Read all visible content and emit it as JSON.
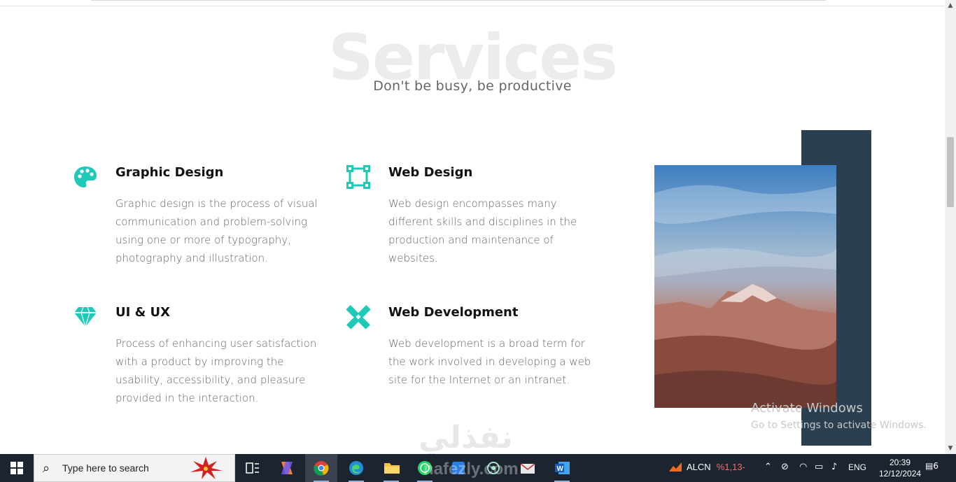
{
  "section": {
    "title": "Services",
    "subtitle": "Don't be busy, be productive"
  },
  "services": [
    {
      "title": "Graphic Design",
      "icon": "palette-icon",
      "description": "Graphic design is the process of visual communication and problem-solving using one or more of typography, photography and illustration."
    },
    {
      "title": "Web Design",
      "icon": "vector-square-icon",
      "description": "Web design encompasses many different skills and disciplines in the production and maintenance of websites."
    },
    {
      "title": "UI & UX",
      "icon": "gem-icon",
      "description": "Process of enhancing user satisfaction with a product by improving the usability, accessibility, and pleasure provided in the interaction."
    },
    {
      "title": "Web Development",
      "icon": "pencil-ruler-icon",
      "description": "Web development is a broad term for the work involved in developing a web site for the Internet or an intranet."
    }
  ],
  "colors": {
    "accent": "#1fc9b8",
    "dark_block": "#2a3f4f"
  },
  "watermarks": {
    "windows_line1": "Activate Windows",
    "windows_line2": "Go to Settings to activate Windows.",
    "site": "نفذلي",
    "site_latin": "nafezly.com"
  },
  "taskbar": {
    "search_placeholder": "Type here to search",
    "stock_name": "ALCN",
    "stock_change": "%1,13-",
    "language": "ENG",
    "time": "20:39",
    "date": "12/12/2024",
    "notifications": "6"
  }
}
